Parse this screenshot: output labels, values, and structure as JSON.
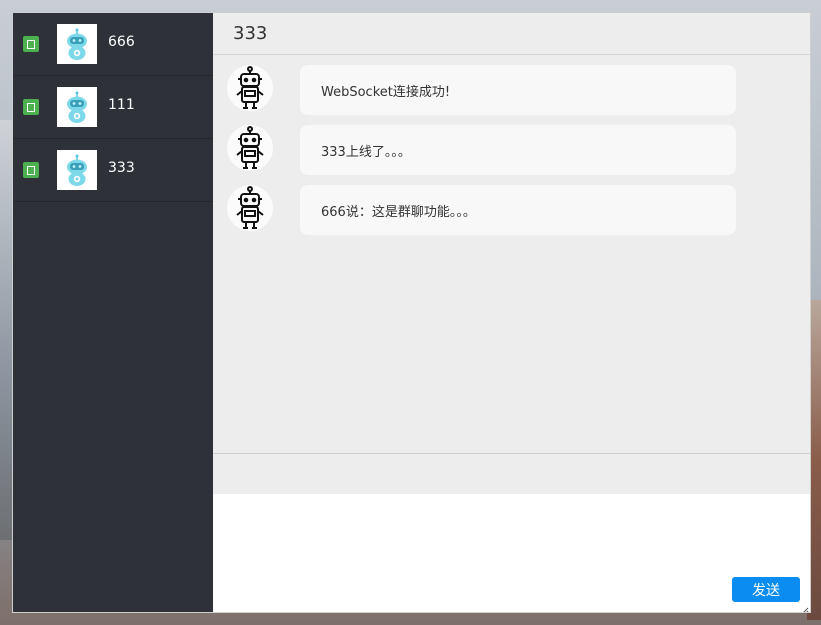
{
  "contacts": [
    {
      "name": "666",
      "status": "online"
    },
    {
      "name": "111",
      "status": "online"
    },
    {
      "name": "333",
      "status": "online"
    }
  ],
  "chat": {
    "title": "333",
    "messages": [
      {
        "text": "WebSocket连接成功!"
      },
      {
        "text": "333上线了。。。"
      },
      {
        "text": "666说：这是群聊功能。。。"
      }
    ]
  },
  "input": {
    "value": ""
  },
  "send_button": {
    "label": "发送"
  },
  "colors": {
    "sidebar": "#2e3238",
    "status_online": "#4caf50",
    "send": "#0a8cf0",
    "bubble": "#f8f8f8"
  },
  "icons": {
    "contact_avatar": "robot-avatar-icon",
    "message_avatar": "robot-line-icon",
    "status": "online-status-icon"
  }
}
